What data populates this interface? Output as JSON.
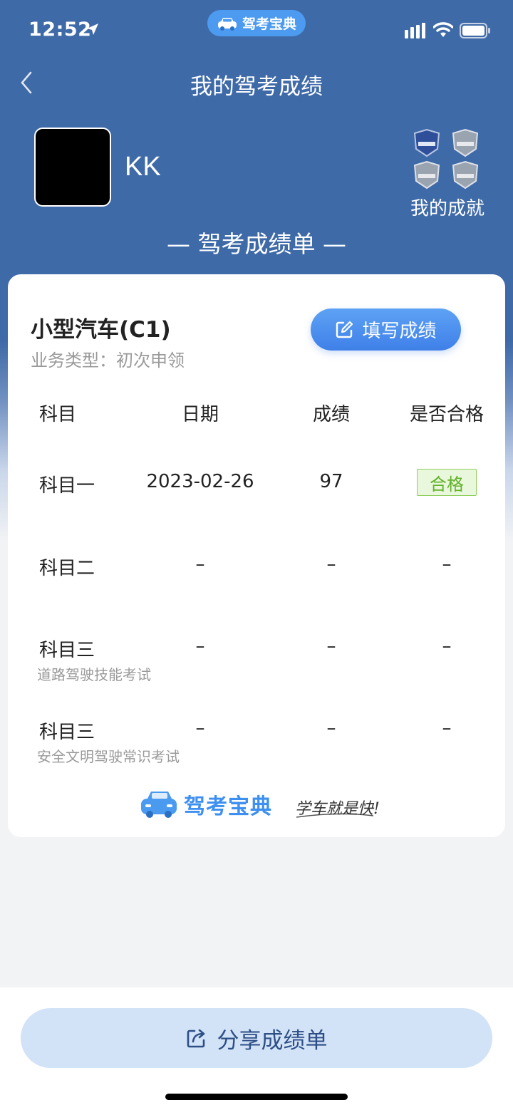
{
  "status_bar": {
    "time": "12:52",
    "pill_label": "驾考宝典"
  },
  "nav": {
    "title": "我的驾考成绩"
  },
  "profile": {
    "username": "KK",
    "achievements_label": "我的成就"
  },
  "sheet": {
    "title": "— 驾考成绩单 —"
  },
  "card": {
    "vehicle": "小型汽车(C1)",
    "business_type": "业务类型：初次申领",
    "fill_button": "填写成绩",
    "headers": [
      "科目",
      "日期",
      "成绩",
      "是否合格"
    ],
    "rows": [
      {
        "subject": "科目一",
        "sub": "",
        "date": "2023-02-26",
        "score": "97",
        "pass": "合格"
      },
      {
        "subject": "科目二",
        "sub": "",
        "date": "–",
        "score": "–",
        "pass": "–"
      },
      {
        "subject": "科目三",
        "sub": "道路驾驶技能考试",
        "date": "–",
        "score": "–",
        "pass": "–"
      },
      {
        "subject": "科目三",
        "sub": "安全文明驾驶常识考试",
        "date": "–",
        "score": "–",
        "pass": "–"
      }
    ],
    "footer_brand": "驾考宝典",
    "footer_slogan": "学车就是快!"
  },
  "share": {
    "label": "分享成绩单"
  },
  "colors": {
    "header_blue": "#3f6aa8",
    "accent_blue": "#4c9bf0",
    "pass_green": "#62b22a"
  }
}
